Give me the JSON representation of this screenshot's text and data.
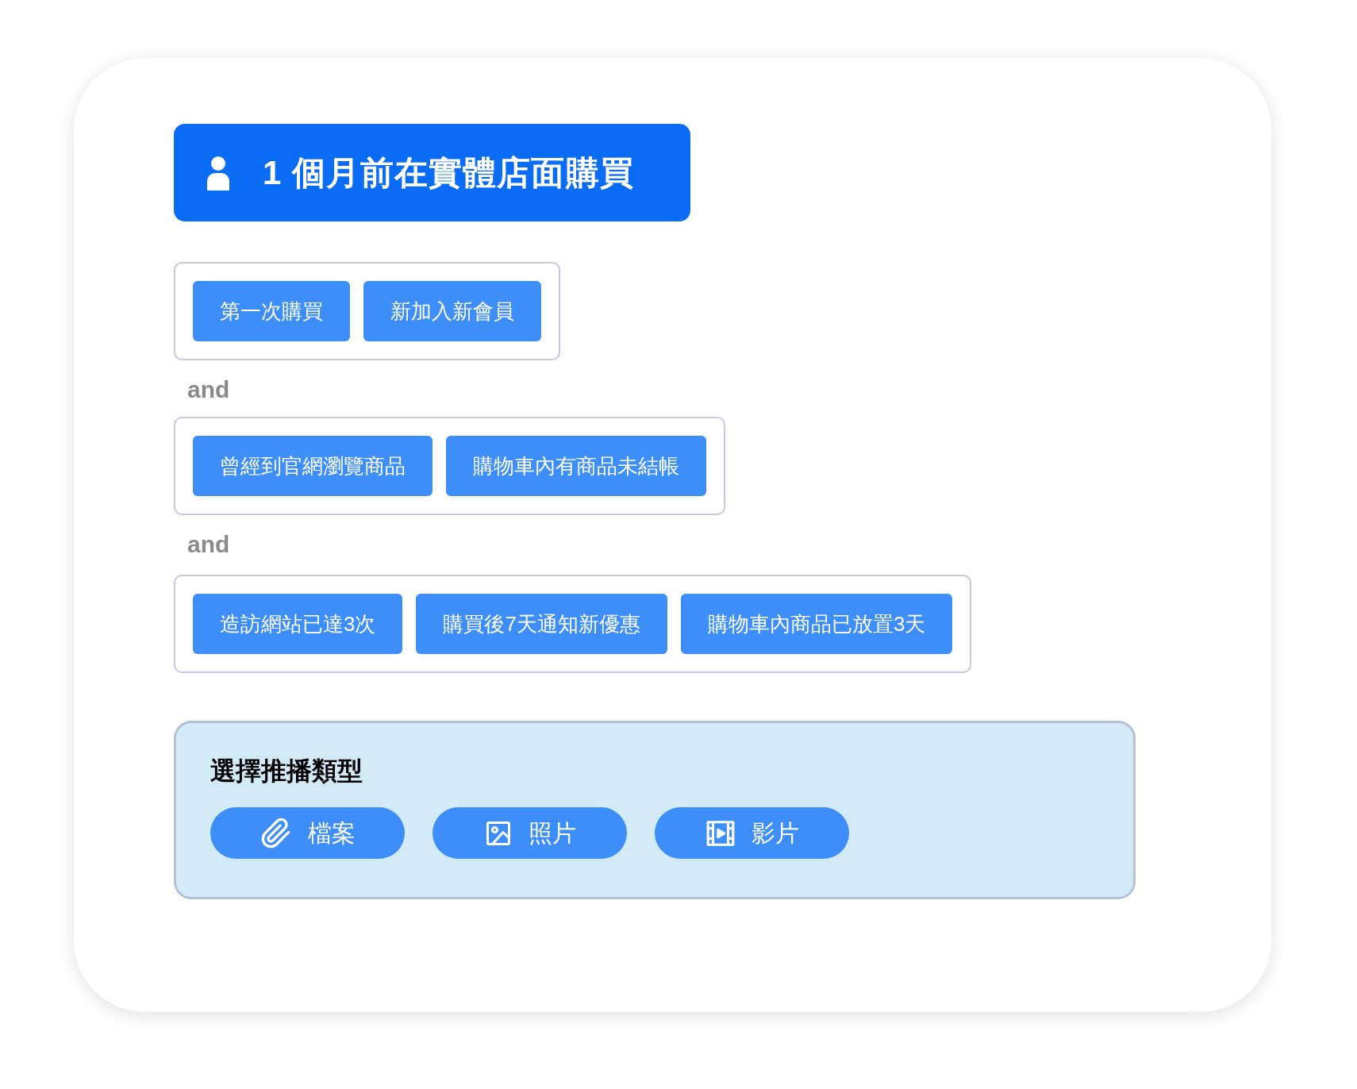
{
  "header": {
    "title": "1 個月前在實體店面購買"
  },
  "groups": [
    {
      "tags": [
        "第一次購買",
        "新加入新會員"
      ]
    },
    {
      "tags": [
        "曾經到官網瀏覽商品",
        "購物車內有商品未結帳"
      ]
    },
    {
      "tags": [
        "造訪網站已達3次",
        "購買後7天通知新優惠",
        "購物車內商品已放置3天"
      ]
    }
  ],
  "connectors": [
    "and",
    "and"
  ],
  "push": {
    "title": "選擇推播類型",
    "buttons": [
      {
        "kind": "file",
        "label": "檔案"
      },
      {
        "kind": "photo",
        "label": "照片"
      },
      {
        "kind": "video",
        "label": "影片"
      }
    ]
  }
}
